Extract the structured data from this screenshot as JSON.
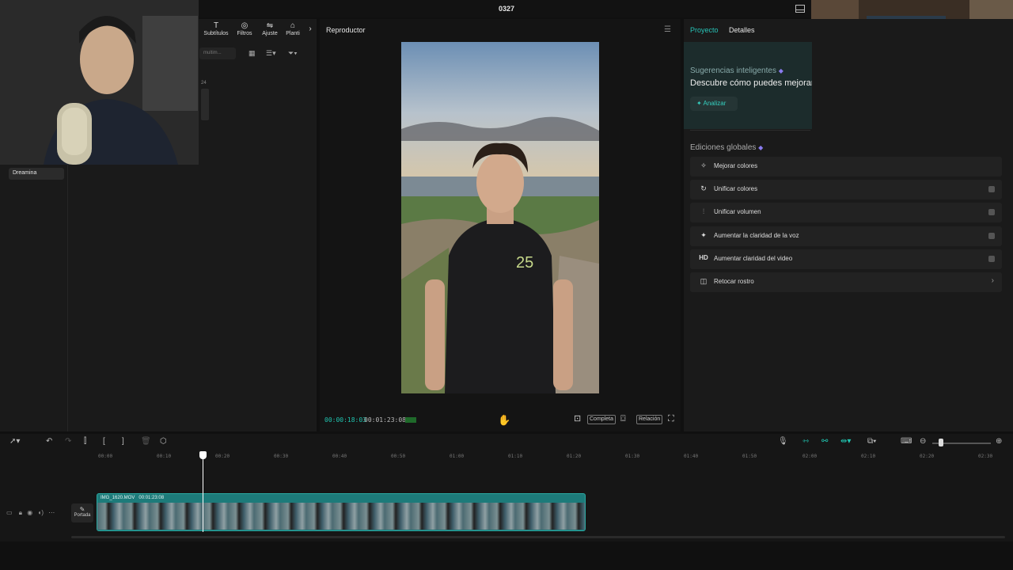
{
  "window": {
    "title": "0327"
  },
  "media": {
    "toolbar": [
      {
        "label": "Subtítulos",
        "icon": "T"
      },
      {
        "label": "Filtros",
        "icon": "◎"
      },
      {
        "label": "Ajuste",
        "icon": "⇋"
      },
      {
        "label": "Planti",
        "icon": "⌂"
      }
    ],
    "more_icon": "›",
    "search_placeholder": "multim...",
    "sidebar_item": "Dreamina",
    "stub_text": "24"
  },
  "player": {
    "title": "Reproductor",
    "time_current": "00:00:18:03",
    "time_total": "00:01:23:08",
    "btn_full": "Completa",
    "btn_ratio": "Relación"
  },
  "right_panel": {
    "tab_project": "Proyecto",
    "tab_details": "Detalles",
    "smart_title": "Sugerencias inteligentes",
    "smart_desc": "Descubre cómo puedes mejorar",
    "analyze_label": "Analizar",
    "global_title": "Ediciones globales",
    "edits": [
      {
        "label": "Mejorar colores",
        "icon": "✧",
        "control": "none"
      },
      {
        "label": "Unificar colores",
        "icon": "↻",
        "control": "toggle"
      },
      {
        "label": "Unificar volumen",
        "icon": "⫶",
        "control": "toggle"
      },
      {
        "label": "Aumentar la claridad de la voz",
        "icon": "✦",
        "control": "toggle"
      },
      {
        "label": "Aumentar claridad del video",
        "icon": "HD",
        "control": "toggle"
      },
      {
        "label": "Retocar rostro",
        "icon": "◫",
        "control": "chevron"
      }
    ]
  },
  "timeline": {
    "ticks": [
      "00:00",
      "00:10",
      "00:20",
      "00:30",
      "00:40",
      "00:50",
      "01:00",
      "01:10",
      "01:20",
      "01:30",
      "01:40",
      "01:50",
      "02:00",
      "02:10",
      "02:20",
      "02:30"
    ],
    "clip_name": "IMG_1620.MOV",
    "clip_duration": "00:01:23:08",
    "cover_label": "Portada"
  },
  "colors": {
    "accent": "#20c4b0",
    "clip": "#1d7b7a",
    "gem": "#8a7cf0"
  }
}
